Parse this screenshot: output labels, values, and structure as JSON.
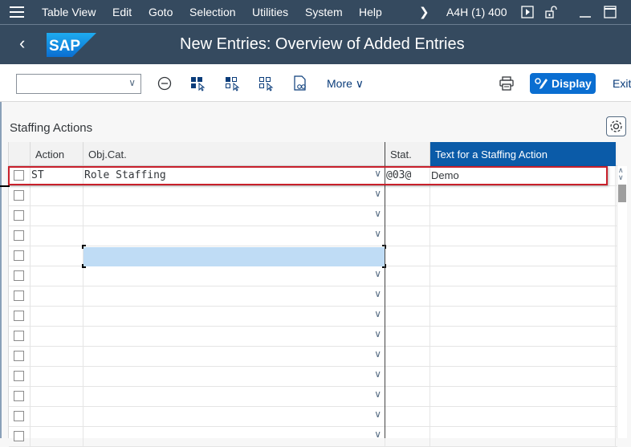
{
  "menubar": {
    "items": [
      "Table View",
      "Edit",
      "Goto",
      "Selection",
      "Utilities",
      "System",
      "Help"
    ],
    "system_id": "A4H (1) 400"
  },
  "shell": {
    "title": "New Entries: Overview of Added Entries",
    "logo_text": "SAP"
  },
  "toolbar": {
    "combo_value": "",
    "more_label": "More",
    "display_label": "Display",
    "exit_label": "Exit"
  },
  "section": {
    "title": "Staffing Actions"
  },
  "table": {
    "columns": [
      "",
      "Action",
      "Obj.Cat.",
      "Stat.",
      "Text for a Staffing Action"
    ],
    "rows": [
      {
        "action": "ST",
        "objcat": "Role Staffing",
        "stat": "@03@",
        "text": "Demo"
      },
      {
        "action": "",
        "objcat": "",
        "stat": "",
        "text": ""
      },
      {
        "action": "",
        "objcat": "",
        "stat": "",
        "text": ""
      },
      {
        "action": "",
        "objcat": "",
        "stat": "",
        "text": ""
      },
      {
        "action": "",
        "objcat": "",
        "stat": "",
        "text": ""
      },
      {
        "action": "",
        "objcat": "",
        "stat": "",
        "text": ""
      },
      {
        "action": "",
        "objcat": "",
        "stat": "",
        "text": ""
      },
      {
        "action": "",
        "objcat": "",
        "stat": "",
        "text": ""
      },
      {
        "action": "",
        "objcat": "",
        "stat": "",
        "text": ""
      },
      {
        "action": "",
        "objcat": "",
        "stat": "",
        "text": ""
      },
      {
        "action": "",
        "objcat": "",
        "stat": "",
        "text": ""
      },
      {
        "action": "",
        "objcat": "",
        "stat": "",
        "text": ""
      },
      {
        "action": "",
        "objcat": "",
        "stat": "",
        "text": ""
      },
      {
        "action": "",
        "objcat": "",
        "stat": "",
        "text": ""
      }
    ]
  },
  "colors": {
    "shell_bg": "#354a5f",
    "accent": "#0a6ed1",
    "selected_header": "#0b5ba8",
    "highlight_border": "#c8202b",
    "focus_cell": "#bfdcf5"
  }
}
